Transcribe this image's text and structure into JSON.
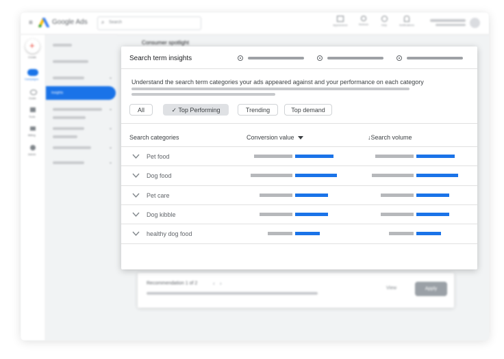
{
  "app": {
    "logo_text": "Google Ads",
    "search_placeholder": "Search",
    "top_actions": [
      "Appearance",
      "Refresh",
      "Help",
      "Notifications"
    ],
    "rail": [
      "Create",
      "Campaigns",
      "Goals",
      "Tools",
      "Billing",
      "Admin"
    ],
    "nav_active": "Insights",
    "page_heading": "Consumer spotlight"
  },
  "panel": {
    "title": "Search term insights",
    "description": "Understand the search term categories your ads appeared against and your performance on each category",
    "filters": [
      {
        "label": "All",
        "selected": false
      },
      {
        "label": "✓ Top Performing",
        "selected": true
      },
      {
        "label": "Trending",
        "selected": false
      },
      {
        "label": "Top demand",
        "selected": false
      }
    ],
    "columns": {
      "category": "Search categories",
      "conversion": "Conversion value",
      "conversion_sort_icon": "dropdown-triangle-icon",
      "volume": "↓Search volume"
    },
    "rows": [
      {
        "label": "Pet food",
        "conversion": 0.68,
        "volume": 0.68
      },
      {
        "label": "Dog food",
        "conversion": 0.74,
        "volume": 0.74
      },
      {
        "label": "Pet care",
        "conversion": 0.58,
        "volume": 0.58
      },
      {
        "label": "Dog kibble",
        "conversion": 0.58,
        "volume": 0.58
      },
      {
        "label": "healthy dog food",
        "conversion": 0.44,
        "volume": 0.44
      }
    ],
    "colors": {
      "accent": "#1a73e8",
      "muted_bar": "#b6b8bb"
    }
  },
  "recommendation": {
    "label": "Recommendation 1 of 2",
    "prev": "‹",
    "next": "›",
    "view_label": "View",
    "apply_label": "Apply"
  }
}
